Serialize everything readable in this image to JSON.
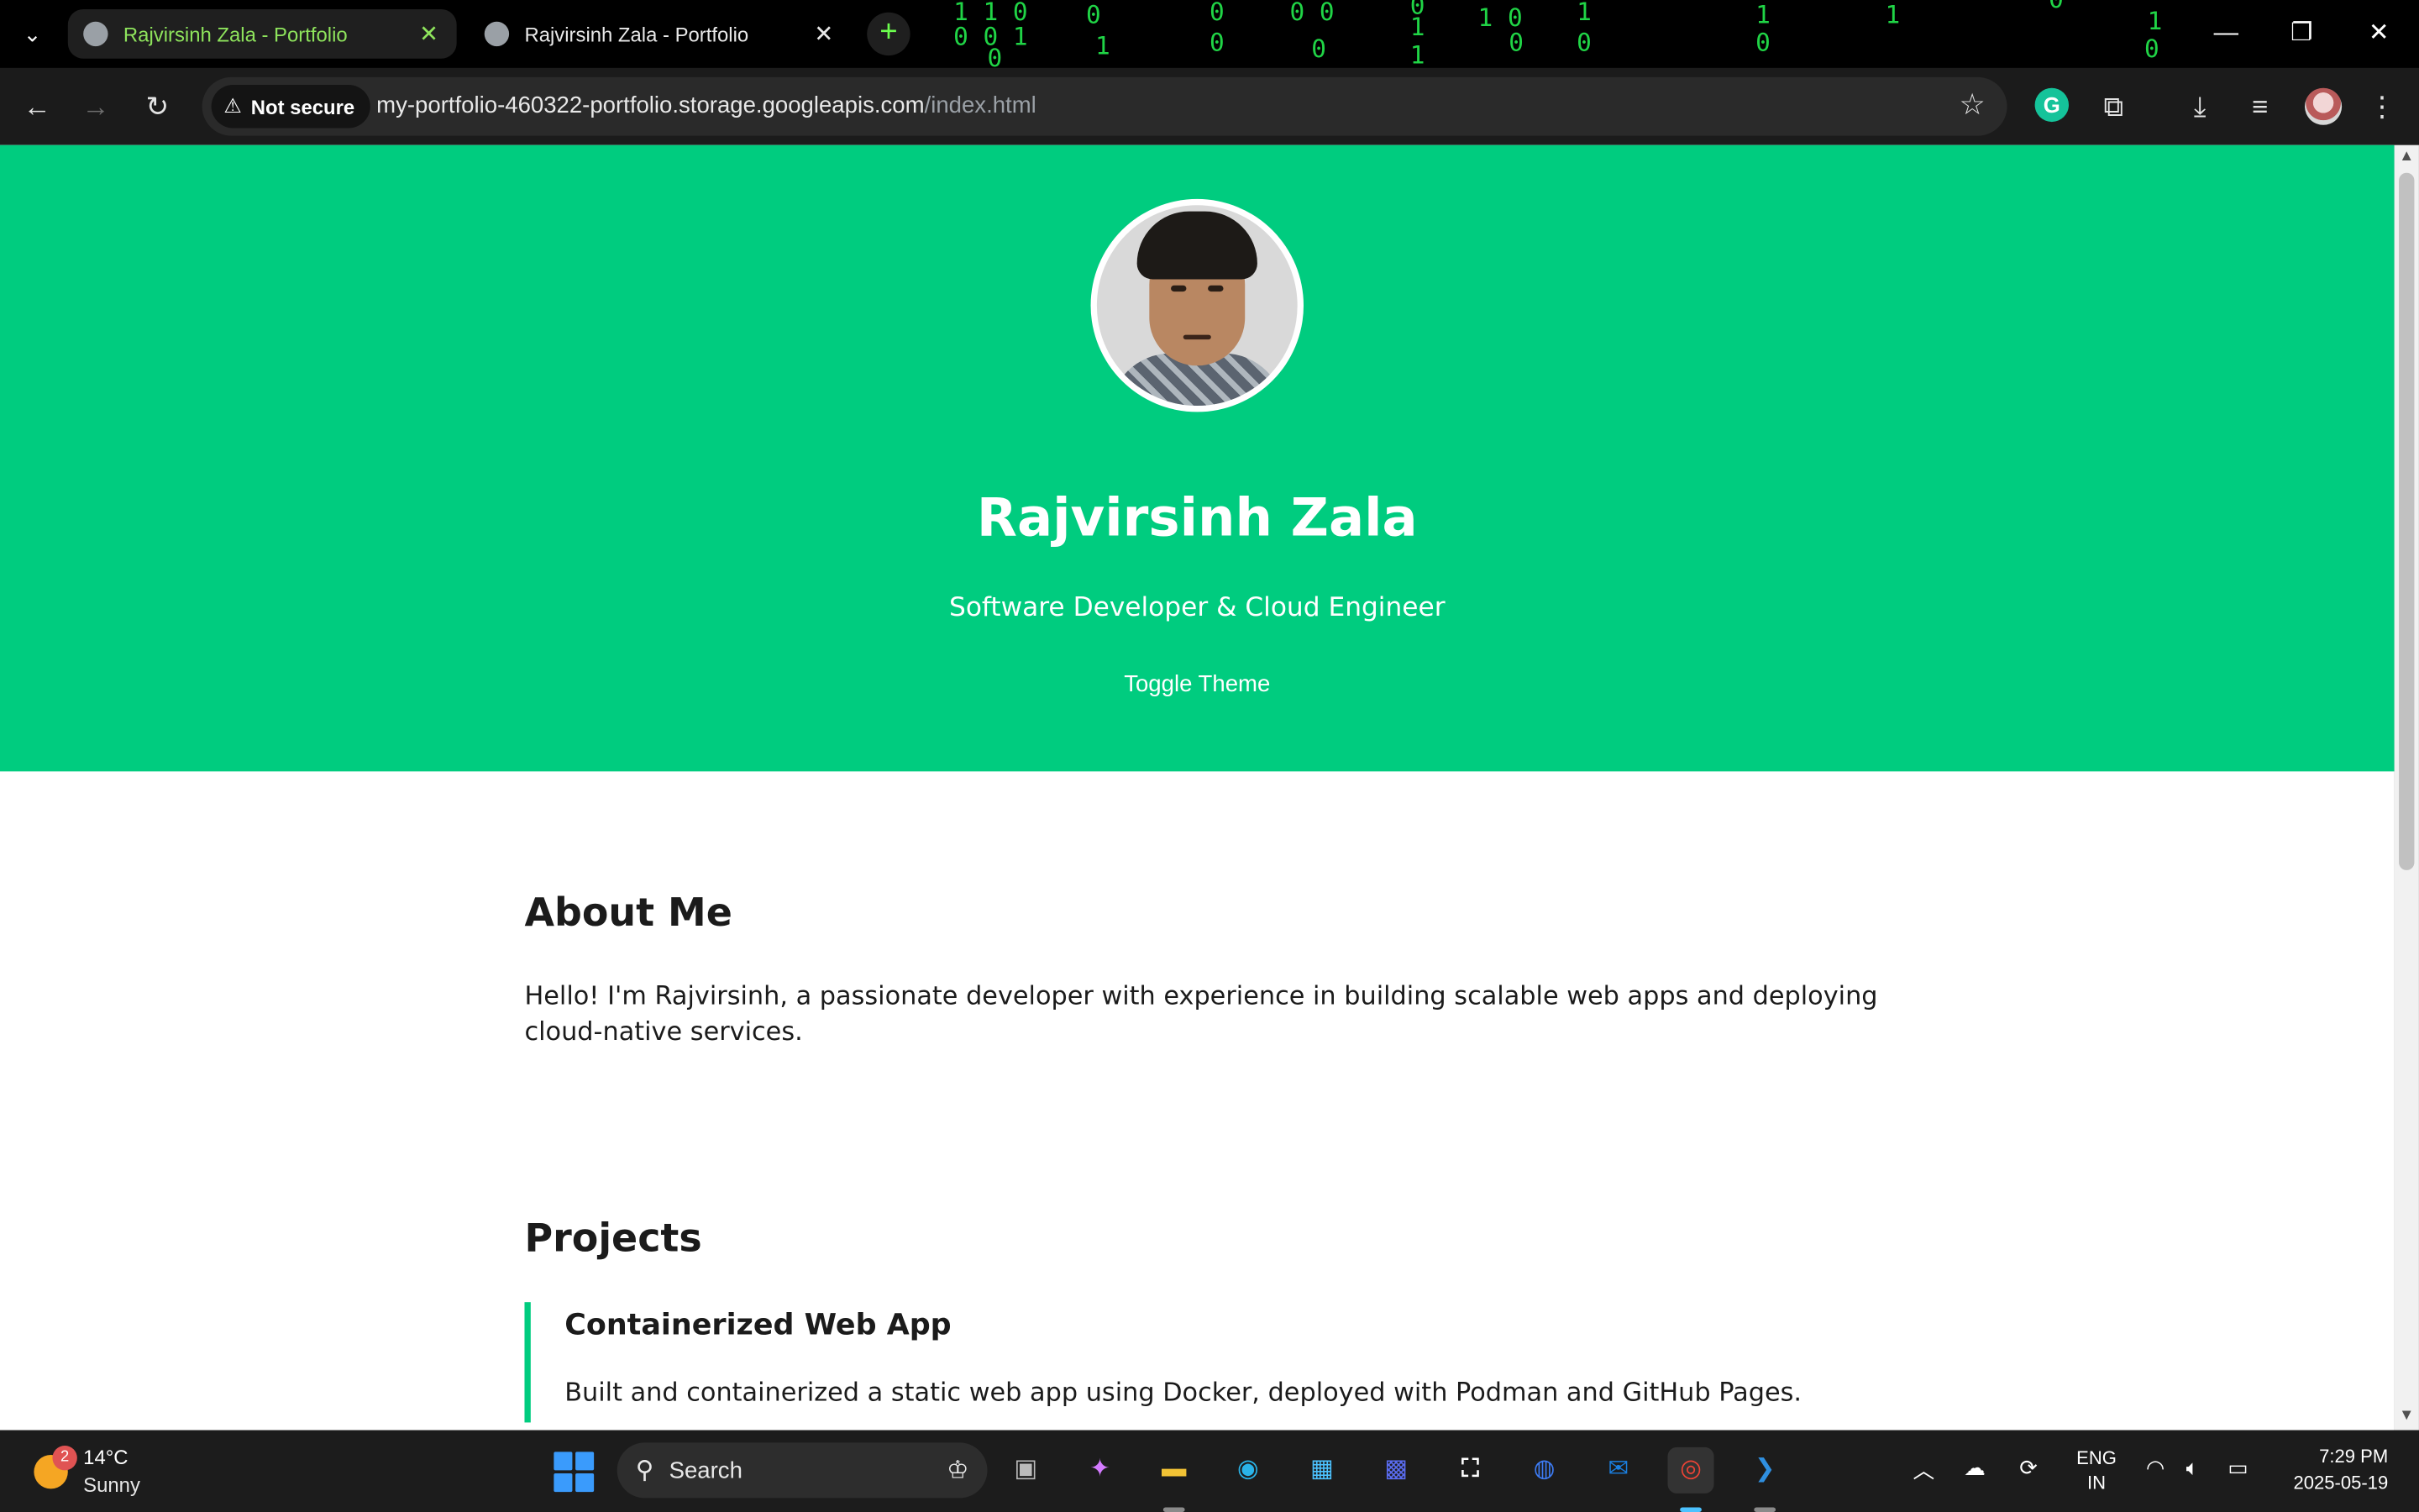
{
  "browser": {
    "tabs": [
      {
        "title": "Rajvirsinh Zala - Portfolio",
        "active": true
      },
      {
        "title": "Rajvirsinh Zala - Portfolio",
        "active": false
      }
    ],
    "security_label": "Not secure",
    "url_host": "my-portfolio-460322-portfolio.storage.googleapis.com",
    "url_path": "/index.html",
    "colors": {
      "tab_accent": "#8ee35c",
      "matrix": "#22e04a"
    }
  },
  "page": {
    "name": "Rajvirsinh Zala",
    "subtitle": "Software Developer & Cloud Engineer",
    "toggle_label": "Toggle Theme",
    "about_heading": "About Me",
    "about_text": "Hello! I'm Rajvirsinh, a passionate developer with experience in building scalable web apps and deploying cloud-native services.",
    "projects_heading": "Projects",
    "projects": [
      {
        "title": "Containerized Web App",
        "description": "Built and containerized a static web app using Docker, deployed with Podman and GitHub Pages."
      }
    ],
    "colors": {
      "hero": "#00cc7f",
      "text": "#1b1b1b"
    }
  },
  "taskbar": {
    "weather_temp": "14°C",
    "weather_condition": "Sunny",
    "weather_badge": "2",
    "search_placeholder": "Search",
    "lang_line1": "ENG",
    "lang_line2": "IN",
    "time": "7:29 PM",
    "date": "2025-05-19"
  }
}
